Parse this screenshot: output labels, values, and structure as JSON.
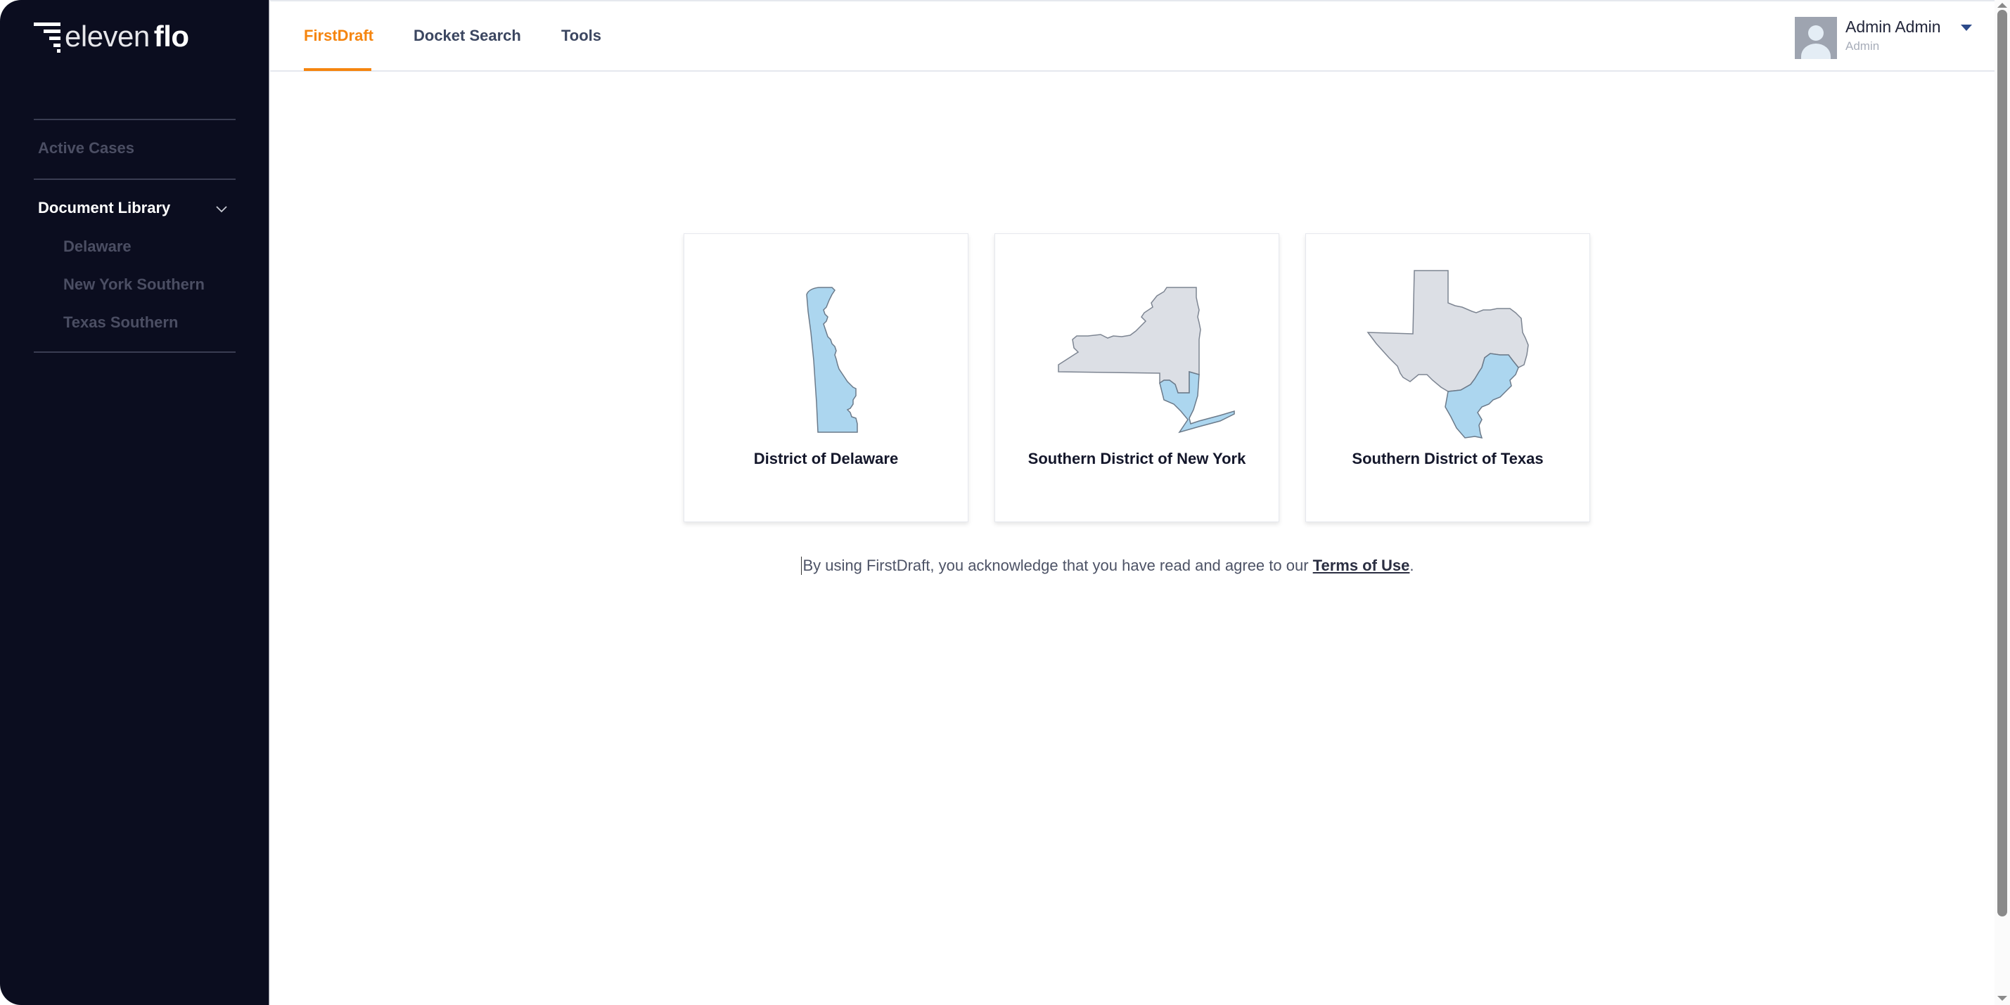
{
  "brand": {
    "logo_light": "eleven",
    "logo_bold": "flo"
  },
  "sidebar": {
    "items": [
      {
        "label": "Active Cases",
        "active": false
      },
      {
        "label": "Document Library",
        "active": true,
        "expanded": true,
        "children": [
          {
            "label": "Delaware"
          },
          {
            "label": "New York Southern"
          },
          {
            "label": "Texas Southern"
          }
        ]
      }
    ]
  },
  "header": {
    "tabs": [
      {
        "label": "FirstDraft",
        "active": true
      },
      {
        "label": "Docket Search",
        "active": false
      },
      {
        "label": "Tools",
        "active": false
      }
    ],
    "user": {
      "name": "Admin Admin",
      "role": "Admin"
    }
  },
  "main": {
    "cards": [
      {
        "title": "District of Delaware",
        "map": "delaware-map-icon"
      },
      {
        "title": "Southern District of New York",
        "map": "new-york-map-icon"
      },
      {
        "title": "Southern District of Texas",
        "map": "texas-map-icon"
      }
    ],
    "terms": {
      "prefix": "By using FirstDraft, you acknowledge that you have read and agree to our ",
      "link": "Terms of Use",
      "suffix": "."
    }
  },
  "colors": {
    "sidebar_bg": "#0b0d1f",
    "accent": "#f5850f",
    "district_highlight": "#acd6ef",
    "state_fill": "#dcdfe5"
  }
}
